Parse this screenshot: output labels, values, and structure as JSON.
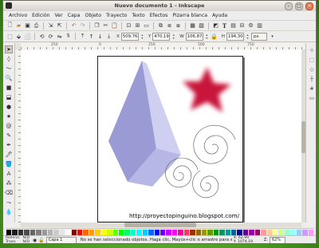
{
  "window": {
    "title": "Nuevo documento 1 - Inkscape"
  },
  "menubar": [
    "Archivo",
    "Edición",
    "Ver",
    "Capa",
    "Objeto",
    "Trayecto",
    "Texto",
    "Efectos",
    "Pizarra blanca",
    "Ayuda"
  ],
  "controls": {
    "x_label": "X",
    "x_value": "509,768",
    "y_label": "Y",
    "y_value": "470,191",
    "w_label": "W",
    "w_value": "106,874",
    "h_label": "H",
    "h_value": "194,304",
    "unit": "px"
  },
  "ruler": {
    "labels": [
      "250",
      "0",
      "250",
      "500",
      "750"
    ]
  },
  "canvas": {
    "url_text": "http://proyectopinguino.blogspot.com/",
    "colors": {
      "prism_front": "#9a9ad4",
      "prism_side": "#cfcff2",
      "prism_bottom": "#b7b7e6",
      "star": "#c8123a",
      "spiral": "#6a6a6a"
    }
  },
  "statusbar": {
    "fill_label": "Relleno:",
    "fill_value": "N/D",
    "stroke_label": "Trazo:",
    "stroke_value": "N/D",
    "layer": "Capa 1",
    "message": "No se han seleccionado objetos. Haga clic, Mayús+clic o arrastre para seleccionar.",
    "x_coord": "X: 62,99",
    "y_coord": "Y: 1074,19",
    "zoom_label": "Z:",
    "zoom": "62%"
  },
  "palette": [
    "#000000",
    "#1a1a1a",
    "#333333",
    "#4d4d4d",
    "#666666",
    "#808080",
    "#999999",
    "#b3b3b3",
    "#cccccc",
    "#e6e6e6",
    "#ffffff",
    "#800000",
    "#ff0000",
    "#ff6600",
    "#ff9900",
    "#ffcc00",
    "#ffff00",
    "#ccff00",
    "#66ff00",
    "#00ff00",
    "#00ff66",
    "#00ffcc",
    "#00ffff",
    "#00ccff",
    "#0066ff",
    "#0000ff",
    "#6600ff",
    "#cc00ff",
    "#ff00ff",
    "#ff0099",
    "#ff3366",
    "#993300",
    "#996600",
    "#999900",
    "#669900",
    "#009900",
    "#009966",
    "#009999",
    "#006699",
    "#000099",
    "#660099",
    "#990099",
    "#990066",
    "#ff9999",
    "#ffcc99",
    "#ffff99",
    "#ccff99",
    "#99ffcc",
    "#99ffff",
    "#99ccff",
    "#cc99ff",
    "#ff99ff"
  ]
}
